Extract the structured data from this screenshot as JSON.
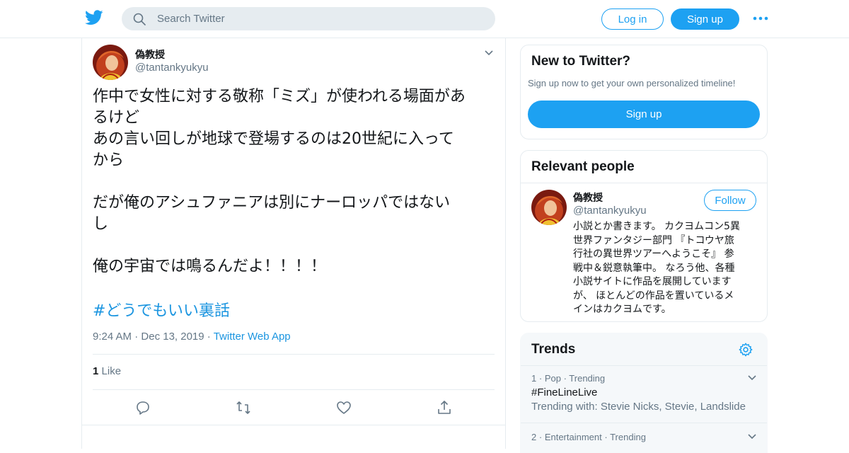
{
  "header": {
    "search_placeholder": "Search Twitter",
    "login_label": "Log in",
    "signup_label": "Sign up",
    "brand_color": "#1da1f2",
    "logo_icon": "twitter-bird-icon",
    "more_icon": "more-dots-icon"
  },
  "tweet": {
    "author_name": "偽教授",
    "author_handle": "@tantankyukyu",
    "lines": [
      "作中で女性に対する敬称「ミズ」が使われる場面があ",
      "るけど",
      "あの言い回しが地球で登場するのは20世紀に入って",
      "から",
      "",
      "だが俺のアシュファニアは別にナーロッパではない",
      "し",
      "",
      "俺の宇宙では鳴るんだよ！！！！"
    ],
    "hashtag": "#どうでもいい裏話",
    "time": "9:24 AM",
    "date": "Dec 13, 2019",
    "app": "Twitter Web App",
    "like_count": "1",
    "like_label": "Like",
    "actions": [
      "reply-icon",
      "retweet-icon",
      "like-icon",
      "share-icon"
    ]
  },
  "new_to_twitter": {
    "title": "New to Twitter?",
    "subtitle": "Sign up now to get your own personalized timeline!",
    "signup_label": "Sign up"
  },
  "relevant_people": {
    "title": "Relevant people",
    "name": "偽教授",
    "handle": "@tantankyukyu",
    "follow_label": "Follow",
    "bio_lines": [
      "小説とか書きます。 カクヨムコン5異",
      "世界ファンタジー部門 『トコウヤ旅",
      "行社の異世界ツアーへようこそ』 参",
      "戦中＆鋭意執筆中。 なろう他、各種",
      "小説サイトに作品を展開しています",
      "が、 ほとんどの作品を置いているメ",
      "インはカクヨムです。"
    ]
  },
  "trends": {
    "title": "Trends",
    "items": [
      {
        "rank": "1",
        "category": "Pop",
        "label": "Trending",
        "name": "#FineLineLive",
        "with": "Trending with: Stevie Nicks, Stevie, Landslide"
      },
      {
        "rank": "2",
        "category": "Entertainment",
        "label": "Trending"
      }
    ]
  }
}
